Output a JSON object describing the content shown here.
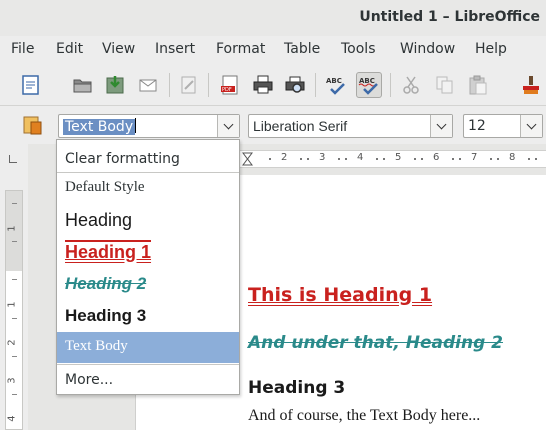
{
  "window": {
    "title": "Untitled 1 – LibreOffice"
  },
  "menubar": {
    "items": [
      {
        "label": "File"
      },
      {
        "label": "Edit"
      },
      {
        "label": "View"
      },
      {
        "label": "Insert"
      },
      {
        "label": "Format"
      },
      {
        "label": "Table"
      },
      {
        "label": "Tools"
      },
      {
        "label": "Window"
      },
      {
        "label": "Help"
      }
    ]
  },
  "toolbar": {
    "icons": [
      "new-document-icon",
      "open-folder-icon",
      "save-icon",
      "email-icon",
      "edit-file-icon",
      "export-pdf-icon",
      "print-icon",
      "print-preview-icon",
      "spellcheck-icon",
      "autospellcheck-icon",
      "cut-icon",
      "copy-icon",
      "paste-icon",
      "clone-formatting-icon"
    ],
    "pdf_label": "PDF",
    "abc_label": "ABC"
  },
  "formatting": {
    "style_value": "Text Body",
    "font_value": "Liberation Serif",
    "size_value": "12"
  },
  "style_dropdown": {
    "items": [
      {
        "label": "Clear formatting"
      },
      {
        "label": "Default Style"
      },
      {
        "label": "Heading"
      },
      {
        "label": "Heading 1"
      },
      {
        "label": "Heading 2"
      },
      {
        "label": "Heading 3"
      },
      {
        "label": "Text Body",
        "selected": true
      },
      {
        "label": "More..."
      }
    ]
  },
  "ruler": {
    "h_numbers": [
      "2",
      "3",
      "4",
      "5",
      "6",
      "7",
      "8"
    ],
    "v_numbers": [
      "1",
      "1",
      "2",
      "3",
      "4"
    ]
  },
  "document": {
    "heading1": "This is Heading 1",
    "heading2": "And under that, Heading 2",
    "heading3": "Heading 3",
    "body": "And of course, the Text Body here..."
  },
  "colors": {
    "heading1": "#c9211e",
    "heading2": "#2a8a8a",
    "selection": "#8caed9"
  }
}
